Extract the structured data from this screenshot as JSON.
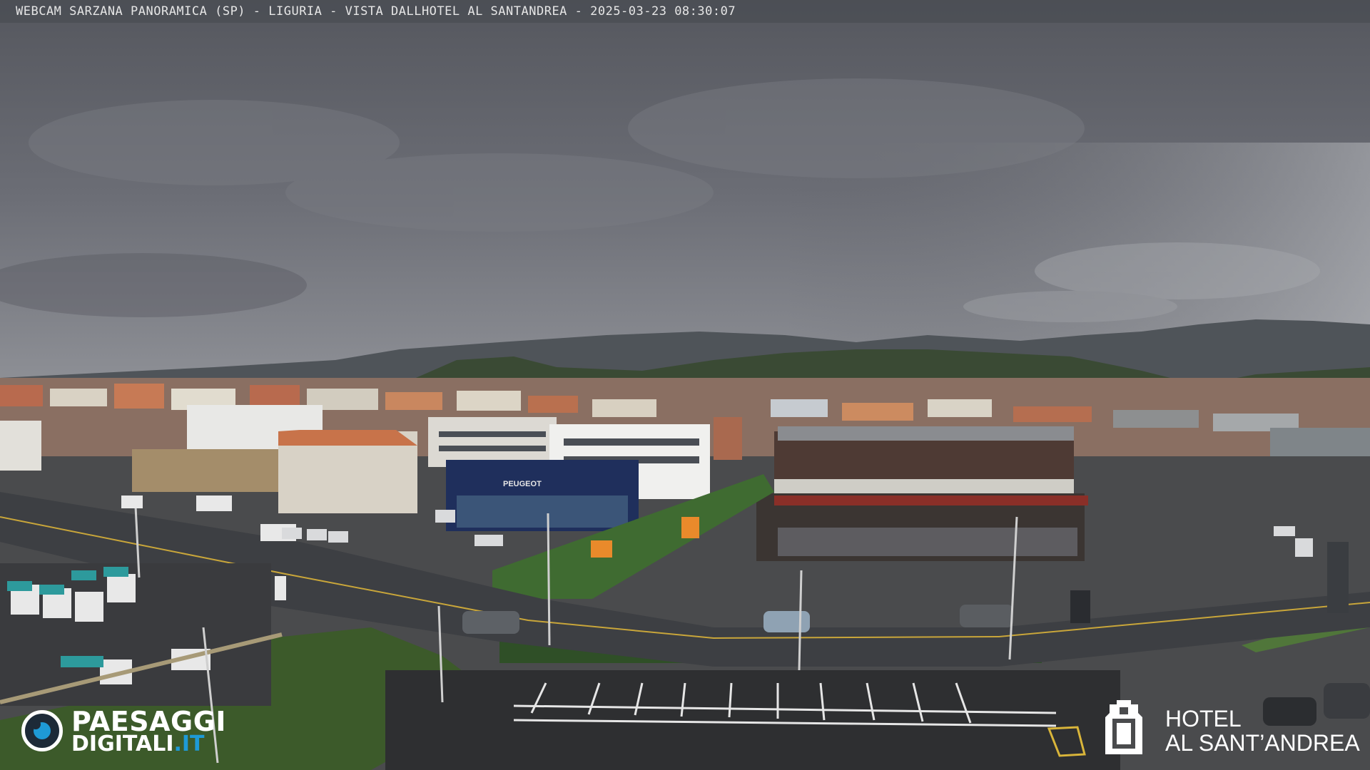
{
  "overlay": {
    "caption": "WEBCAM SARZANA PANORAMICA (SP) - LIGURIA - VISTA DALLHOTEL AL SANTANDREA - 2025-03-23  08:30:07"
  },
  "logo_left": {
    "line1": "PAESAGGI",
    "line2_main": "DIGITALI",
    "line2_suffix": ".IT",
    "accent_color": "#1e9ad6"
  },
  "logo_right": {
    "line1": "HOTEL",
    "line2": "AL SANT’ANDREA",
    "icon": "hotel-building-icon"
  },
  "signs": {
    "peugeot": "PEUGEOT"
  },
  "colors": {
    "sky": "#62646b",
    "road": "#3f4146",
    "vegetation": "#3d5a2c"
  }
}
